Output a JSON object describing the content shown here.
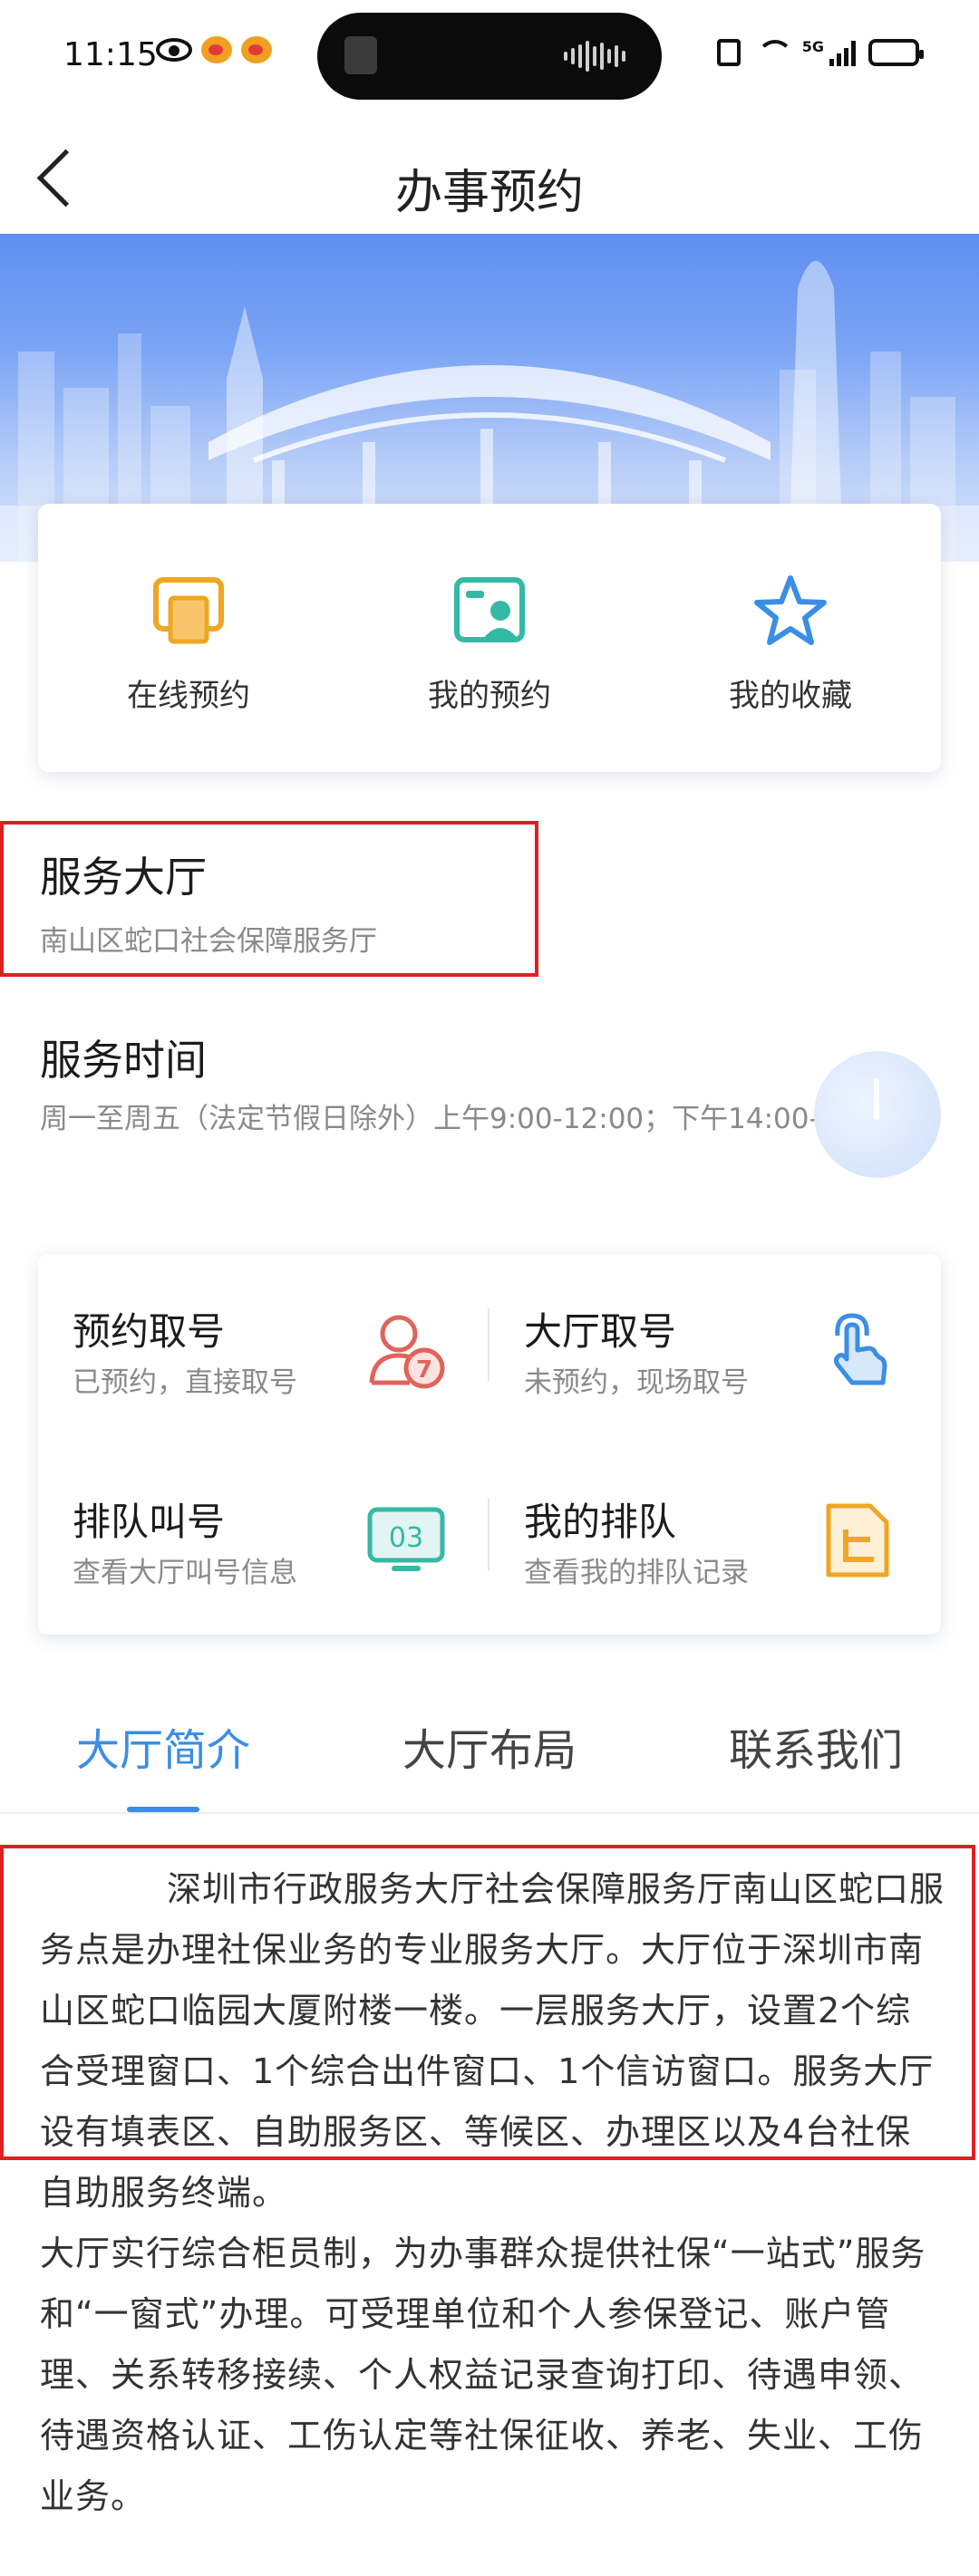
{
  "status_bar": {
    "time": "11:15",
    "network": "5G"
  },
  "nav": {
    "title": "办事预约"
  },
  "quick_actions": [
    {
      "label": "在线预约",
      "icon": "calendar-window-icon",
      "color": "#f0a623"
    },
    {
      "label": "我的预约",
      "icon": "person-card-icon",
      "color": "#34b9a5"
    },
    {
      "label": "我的收藏",
      "icon": "star-icon",
      "color": "#3a8ee6"
    }
  ],
  "hall": {
    "title": "服务大厅",
    "name": "南山区蛇口社会保障服务厅"
  },
  "hours": {
    "title": "服务时间",
    "text": "周一至周五（法定节假日除外）上午9:00-12:00；下午14:00-18:00"
  },
  "services": [
    {
      "title": "预约取号",
      "sub": "已预约，直接取号",
      "icon": "appointment-number-icon",
      "color": "#e0645a"
    },
    {
      "title": "大厅取号",
      "sub": "未预约，现场取号",
      "icon": "tap-hand-icon",
      "color": "#3a8ee6"
    },
    {
      "title": "排队叫号",
      "sub": "查看大厅叫号信息",
      "icon": "queue-display-icon",
      "color": "#34b9a5",
      "icon_text": "03"
    },
    {
      "title": "我的排队",
      "sub": "查看我的排队记录",
      "icon": "document-list-icon",
      "color": "#f0a623"
    }
  ],
  "tabs": [
    {
      "label": "大厅简介",
      "active": true
    },
    {
      "label": "大厅布局",
      "active": false
    },
    {
      "label": "联系我们",
      "active": false
    }
  ],
  "intro": {
    "para1": "深圳市行政服务大厅社会保障服务厅南山区蛇口服务点是办理社保业务的专业服务大厅。大厅位于深圳市南山区蛇口临园大厦附楼一楼。一层服务大厅，设置2个综合受理窗口、1个综合出件窗口、1个信访窗口。服务大厅设有填表区、自助服务区、等候区、办理区以及4台社保自助服务终端。",
    "para2": "大厅实行综合柜员制，为办事群众提供社保“一站式”服务和“一窗式”办理。可受理单位和个人参保登记、账户管理、关系转移接续、个人权益记录查询打印、待遇申领、待遇资格认证、工伤认定等社保征收、养老、失业、工伤业务。"
  },
  "colors": {
    "accent": "#3a8ee6",
    "highlight_box": "#e02020"
  }
}
